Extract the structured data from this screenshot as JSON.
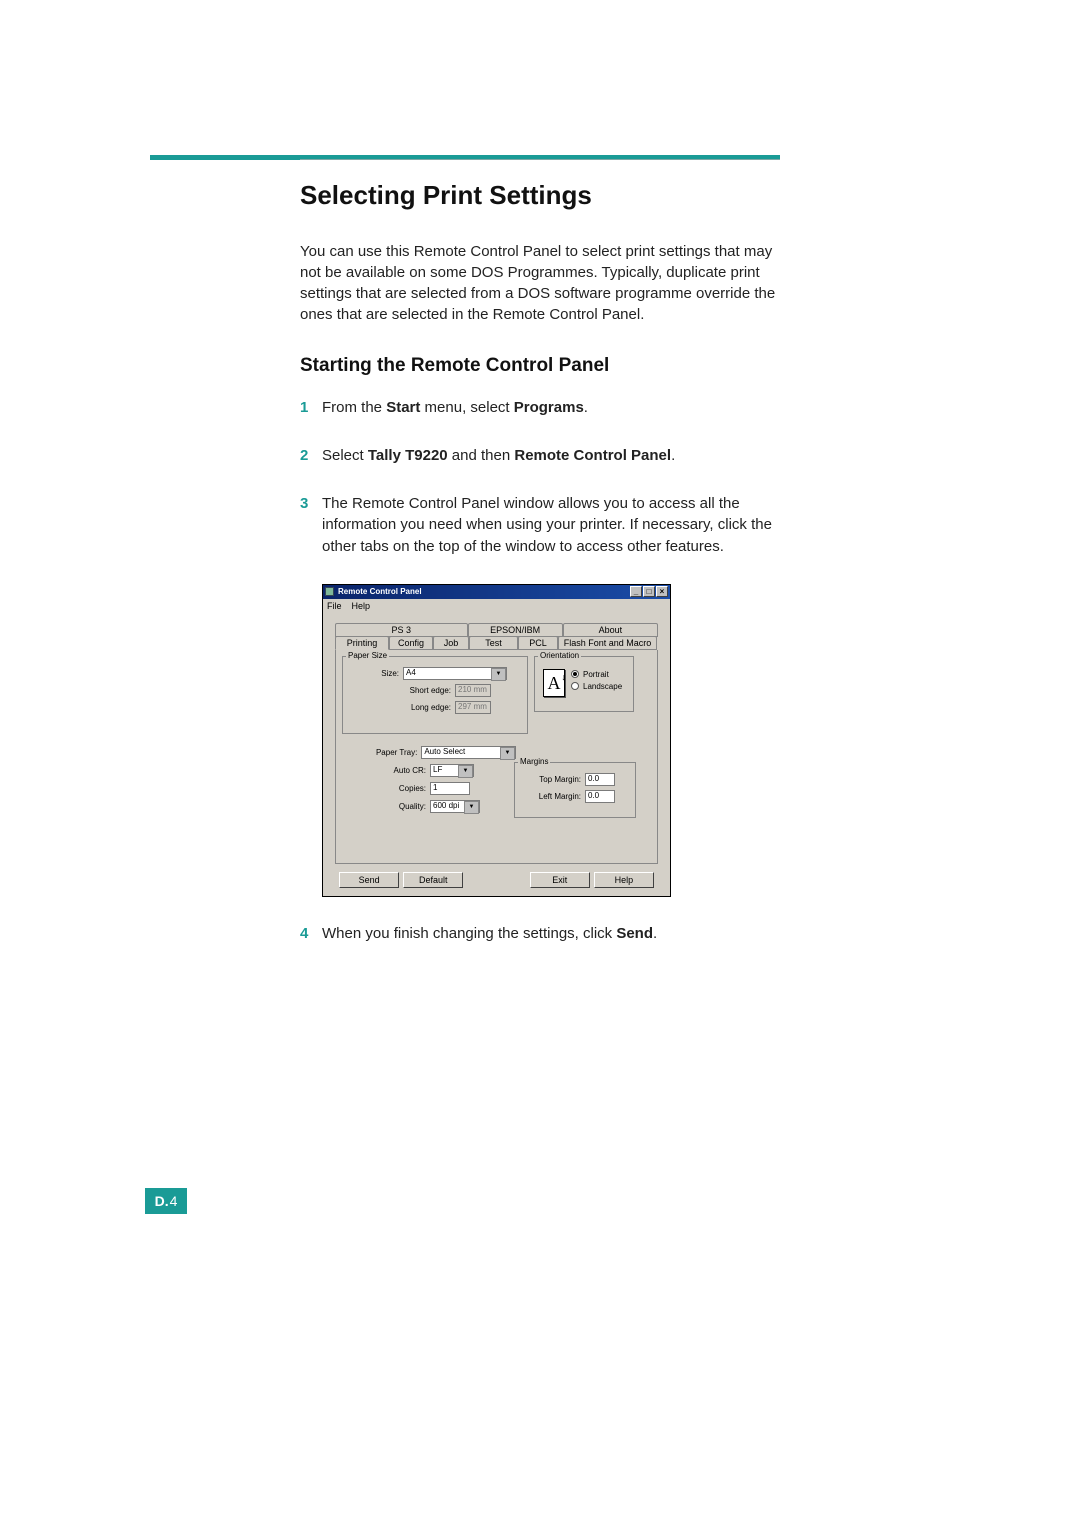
{
  "page_title": "Selecting Print Settings",
  "intro": "You can use this Remote Control Panel to select print settings that may not be available on some DOS Programmes. Typically, duplicate print settings that are selected from a DOS software programme override the ones that are selected in the Remote Control Panel.",
  "subheading": "Starting the Remote Control Panel",
  "steps": {
    "s1_a": "From the ",
    "s1_b": "Start",
    "s1_c": " menu, select ",
    "s1_d": "Programs",
    "s1_e": ".",
    "s2_a": "Select ",
    "s2_b": "Tally T9220",
    "s2_c": " and then ",
    "s2_d": "Remote Control Panel",
    "s2_e": ".",
    "s3": "The Remote Control Panel window allows you to access all the information you need when using your printer. If necessary, click the other tabs on the top of the window to access other features.",
    "s4_a": "When you finish changing the settings, click ",
    "s4_b": "Send",
    "s4_c": "."
  },
  "page_number": {
    "prefix": "D.",
    "num": "4"
  },
  "dialog": {
    "title": "Remote Control Panel",
    "menu": {
      "file": "File",
      "help": "Help"
    },
    "tabs_top": {
      "ps3": "PS 3",
      "epson": "EPSON/IBM",
      "about": "About"
    },
    "tabs_bottom": {
      "printing": "Printing",
      "config": "Config",
      "job": "Job",
      "test": "Test",
      "pcl": "PCL",
      "flash": "Flash Font and Macro"
    },
    "paper_size": {
      "legend": "Paper Size",
      "size_label": "Size:",
      "size_value": "A4",
      "short_label": "Short edge:",
      "short_value": "210 mm",
      "long_label": "Long edge:",
      "long_value": "297 mm"
    },
    "orientation": {
      "legend": "Orientation",
      "portrait": "Portrait",
      "landscape": "Landscape",
      "preview_letter": "A"
    },
    "mid": {
      "paper_tray_label": "Paper Tray:",
      "paper_tray_value": "Auto Select",
      "auto_cr_label": "Auto CR:",
      "auto_cr_value": "LF",
      "copies_label": "Copies:",
      "copies_value": "1",
      "quality_label": "Quality:",
      "quality_value": "600 dpi"
    },
    "margins": {
      "legend": "Margins",
      "top_label": "Top Margin:",
      "top_value": "0.0",
      "left_label": "Left Margin:",
      "left_value": "0.0"
    },
    "buttons": {
      "send": "Send",
      "default": "Default",
      "exit": "Exit",
      "help": "Help"
    },
    "win_buttons": {
      "min": "_",
      "max": "□",
      "close": "×"
    }
  }
}
